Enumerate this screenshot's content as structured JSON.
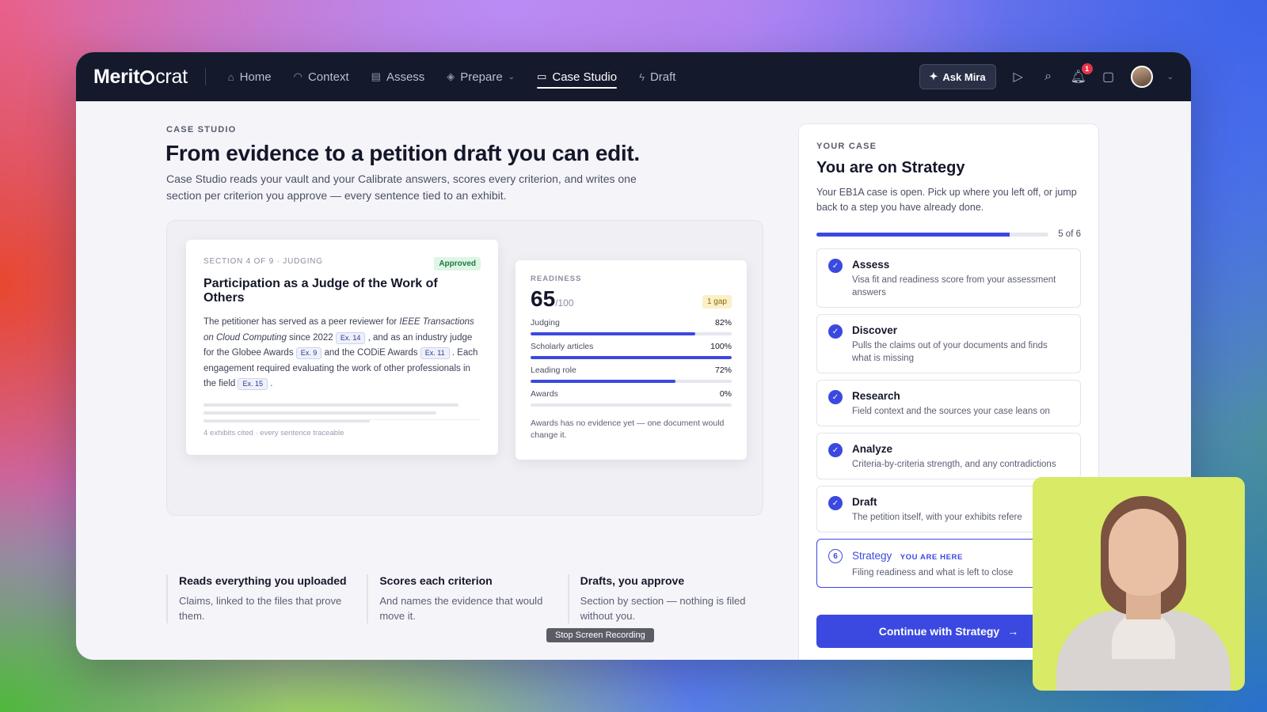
{
  "nav": {
    "logo_prefix": "Merit",
    "logo_suffix": "crat",
    "items": [
      {
        "label": "Home",
        "icon": "home-icon"
      },
      {
        "label": "Context",
        "icon": "context-icon"
      },
      {
        "label": "Assess",
        "icon": "clipboard-icon"
      },
      {
        "label": "Prepare",
        "icon": "layers-icon"
      },
      {
        "label": "Case Studio",
        "icon": "folder-icon"
      },
      {
        "label": "Draft",
        "icon": "bolt-icon"
      }
    ],
    "active": "Case Studio",
    "ask_label": "Ask Mira",
    "notification_count": "1"
  },
  "hero": {
    "eyebrow": "CASE STUDIO",
    "title": "From evidence to a petition draft you can edit.",
    "subtitle": "Case Studio reads your vault and your Calibrate answers, scores every criterion, and writes one section per criterion you approve — every sentence tied to an exhibit."
  },
  "section_card": {
    "meta": "SECTION 4 OF 9 · JUDGING",
    "status": "Approved",
    "title": "Participation as a Judge of the Work of Others",
    "body_1": "The petitioner has served as a peer reviewer for ",
    "journal": "IEEE Transactions on Cloud Computing",
    "body_2": " since 2022 ",
    "ex_1": "Ex. 14",
    "body_3": " , and as an industry judge for the Globee Awards ",
    "ex_2": "Ex. 9",
    "body_4": " and the CODiE Awards ",
    "ex_3": "Ex. 11",
    "body_5": " . Each engagement required evaluating the work of other professionals in the field ",
    "ex_4": "Ex. 15",
    "body_6": " .",
    "footer": "4 exhibits cited · every sentence traceable"
  },
  "readiness": {
    "label": "READINESS",
    "score": "65",
    "denominator": "/100",
    "gap_badge": "1 gap",
    "metrics": [
      {
        "name": "Judging",
        "pct_label": "82%",
        "value": 82
      },
      {
        "name": "Scholarly articles",
        "pct_label": "100%",
        "value": 100
      },
      {
        "name": "Leading role",
        "pct_label": "72%",
        "value": 72
      },
      {
        "name": "Awards",
        "pct_label": "0%",
        "value": 0
      }
    ],
    "note": "Awards has no evidence yet — one document would change it."
  },
  "features": [
    {
      "title": "Reads everything you uploaded",
      "desc": "Claims, linked to the files that prove them."
    },
    {
      "title": "Scores each criterion",
      "desc": "And names the evidence that would move it."
    },
    {
      "title": "Drafts, you approve",
      "desc": "Section by section — nothing is filed without you."
    }
  ],
  "recording_label": "Stop Screen Recording",
  "case": {
    "eyebrow": "YOUR CASE",
    "title": "You are on Strategy",
    "desc": "Your EB1A case is open. Pick up where you left off, or jump back to a step you have already done.",
    "progress_text": "5 of 6",
    "progress_value": 0.833,
    "steps": [
      {
        "title": "Assess",
        "desc": "Visa fit and readiness score from your assessment answers",
        "done": true
      },
      {
        "title": "Discover",
        "desc": "Pulls the claims out of your documents and finds what is missing",
        "done": true
      },
      {
        "title": "Research",
        "desc": "Field context and the sources your case leans on",
        "done": true
      },
      {
        "title": "Analyze",
        "desc": "Criteria-by-criteria strength, and any contradictions",
        "done": true
      },
      {
        "title": "Draft",
        "desc": "The petition itself, with your exhibits refere",
        "done": true
      }
    ],
    "current_step": {
      "number": "6",
      "title": "Strategy",
      "tag": "YOU ARE HERE",
      "desc": "Filing readiness and what is left to close"
    },
    "continue_label": "Continue with Strategy",
    "continue_arrow": "→"
  },
  "colors": {
    "accent": "#3b49e0",
    "navbar": "#141a2c",
    "approved_bg": "#dff5e6",
    "gap_bg": "#fbf0c8"
  }
}
